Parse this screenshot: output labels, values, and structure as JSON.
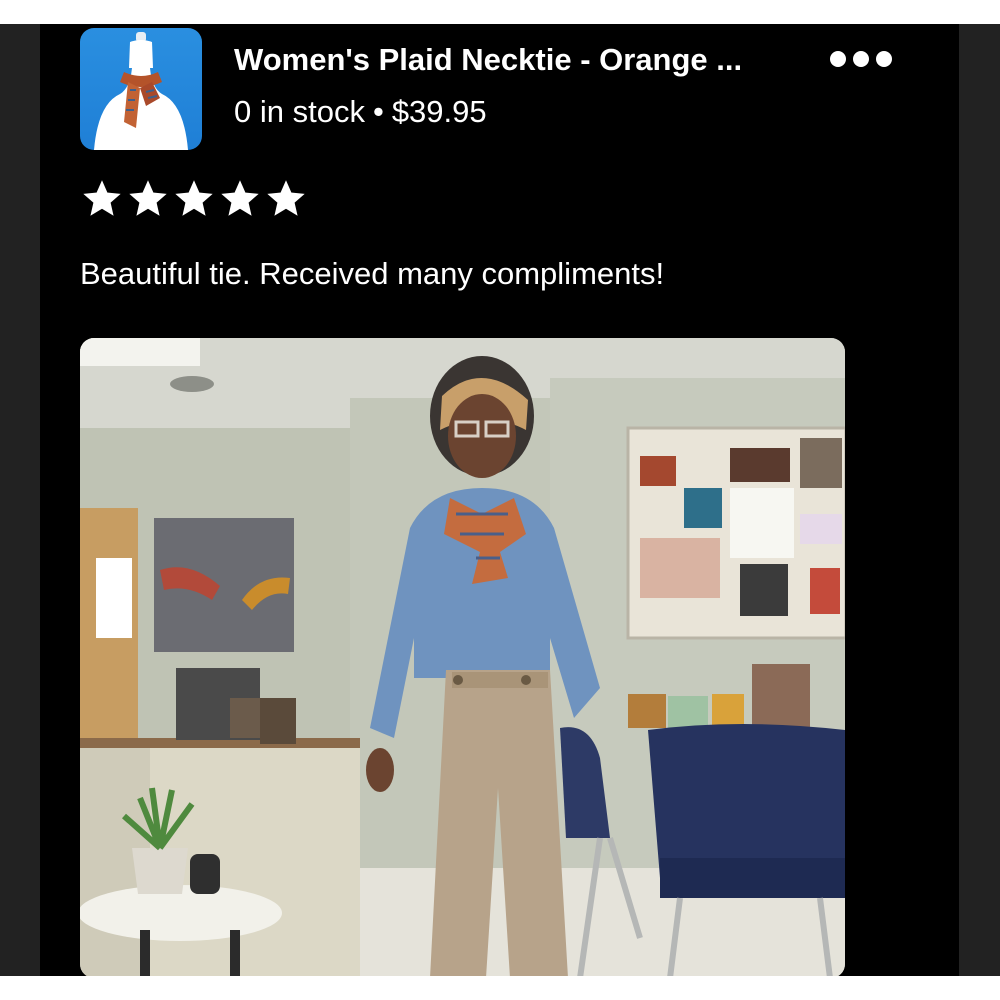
{
  "product": {
    "title": "Women's Plaid Necktie - Orange ...",
    "stock": "0 in stock",
    "separator": "•",
    "price": "$39.95",
    "thumbnail_icon": "mannequin-necktie-thumbnail"
  },
  "menu": {
    "icon": "more-options-icon"
  },
  "review": {
    "rating": 5,
    "rating_max": 5,
    "text": "Beautiful tie. Received many compliments!"
  },
  "photo": {
    "scene": "review-photo"
  },
  "colors": {
    "background": "#000000",
    "text": "#ffffff",
    "thumbnail_bg": "#1f7fd6",
    "star": "#ffffff"
  }
}
